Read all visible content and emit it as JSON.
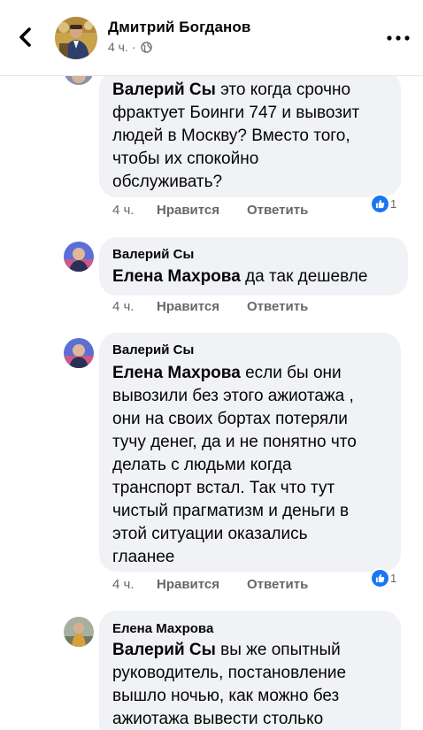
{
  "header": {
    "name": "Дмитрий Богданов",
    "time": "4 ч. ·"
  },
  "comments": [
    {
      "author": "",
      "mention": "Валерий Сы",
      "text_lines": [
        " это когда срочно",
        "фрактует Боинги 747 и вывозит",
        "людей в Москву? Вместо того,",
        "чтобы их спокойно",
        "обслуживать?"
      ],
      "time": "4 ч.",
      "like": "Нравится",
      "reply": "Ответить",
      "reactions": "1"
    },
    {
      "author": "Валерий Сы",
      "mention": "Елена Махрова",
      "text_lines": [
        " да так дешевле"
      ],
      "time": "4 ч.",
      "like": "Нравится",
      "reply": "Ответить"
    },
    {
      "author": "Валерий Сы",
      "mention": "Елена Махрова",
      "text_lines": [
        " если бы они",
        "вывозили без этого ажиотажа ,",
        "они на своих бортах потеряли",
        "тучу денег, да и не понятно что",
        "делать с людьми когда",
        "транспорт встал. Так что тут",
        "чистый прагматизм и деньги в",
        "этой ситуации оказались",
        "глаанее"
      ],
      "time": "4 ч.",
      "like": "Нравится",
      "reply": "Ответить",
      "reactions": "1"
    },
    {
      "author": "Елена Махрова",
      "mention": "Валерий Сы",
      "text_lines": [
        " вы же опытный",
        "руководитель, постановление",
        "вышло ночью, как можно без",
        "ажиотажа вывести столько"
      ]
    }
  ],
  "colors": {
    "reaction": "#1877f2",
    "bubble": "#f0f2f5",
    "meta": "#65676b"
  },
  "icons": {
    "back": "chevron-left-icon",
    "more": "more-horizontal-icon",
    "audience": "globe-icon",
    "reaction": "like-icon"
  }
}
